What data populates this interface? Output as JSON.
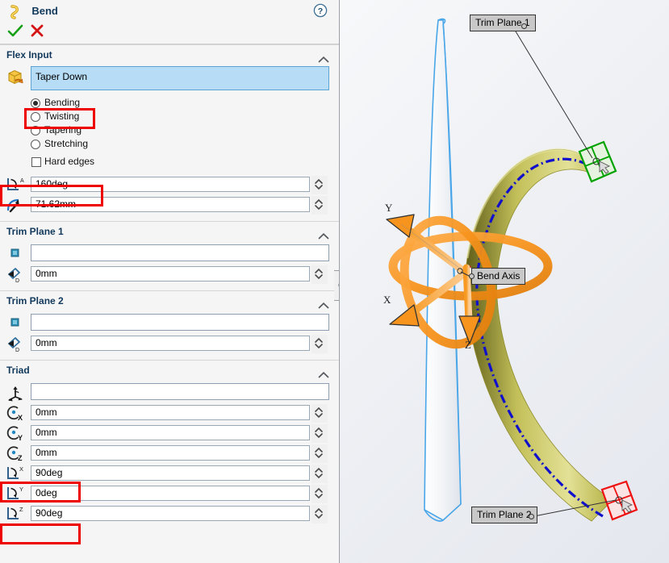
{
  "panel": {
    "title": "Bend",
    "title_icon": "bend-feature-icon",
    "help_icon": "help-question-icon",
    "ok_icon": "green-check-icon",
    "cancel_icon": "red-x-icon",
    "sections": {
      "flex_input": {
        "label": "Flex Input",
        "body_selection": "Taper Down",
        "body_icon": "solid-body-icon",
        "options": [
          {
            "label": "Bending",
            "selected": true
          },
          {
            "label": "Twisting",
            "selected": false
          },
          {
            "label": "Tapering",
            "selected": false
          },
          {
            "label": "Stretching",
            "selected": false
          }
        ],
        "hard_edges": {
          "label": "Hard edges",
          "checked": false
        },
        "angle": {
          "icon": "bend-angle-icon",
          "value": "160deg"
        },
        "radius": {
          "icon": "bend-radius-icon",
          "value": "71.62mm"
        }
      },
      "trim_plane_1": {
        "label": "Trim Plane 1",
        "plane_icon": "plane-select-icon",
        "plane_selection": "",
        "distance_icon": "trim-distance-icon",
        "distance": "0mm"
      },
      "trim_plane_2": {
        "label": "Trim Plane 2",
        "plane_icon": "plane-select-icon",
        "plane_selection": "",
        "distance_icon": "trim-distance-icon",
        "distance": "0mm"
      },
      "triad": {
        "label": "Triad",
        "reference_icon": "triad-reference-icon",
        "reference_selection": "",
        "fields": [
          {
            "icon": "rotate-origin-x-icon",
            "value": "0mm",
            "highlight": false
          },
          {
            "icon": "rotate-origin-y-icon",
            "value": "0mm",
            "highlight": false
          },
          {
            "icon": "rotate-origin-z-icon",
            "value": "0mm",
            "highlight": false
          },
          {
            "icon": "rotate-angle-x-icon",
            "value": "90deg",
            "highlight": true
          },
          {
            "icon": "rotate-angle-y-icon",
            "value": "0deg",
            "highlight": false
          },
          {
            "icon": "rotate-angle-z-icon",
            "value": "90deg",
            "highlight": true
          }
        ]
      }
    }
  },
  "viewport": {
    "callouts": [
      {
        "text": "Trim Plane 1"
      },
      {
        "text": "Bend Axis"
      },
      {
        "text": "Trim Plane 2"
      }
    ],
    "axis_labels": [
      "Y",
      "X",
      "Z"
    ]
  },
  "colors": {
    "accent_heading": "#12395b",
    "highlight_red": "#ee0000",
    "selection_blue": "#b7dcf5",
    "triad_orange": "#f7941e",
    "trim_plane_1_green": "#00a200",
    "trim_plane_2_red": "#ee1111",
    "body_yellow": "#d9d66a",
    "centerline_blue": "#1010cc"
  }
}
